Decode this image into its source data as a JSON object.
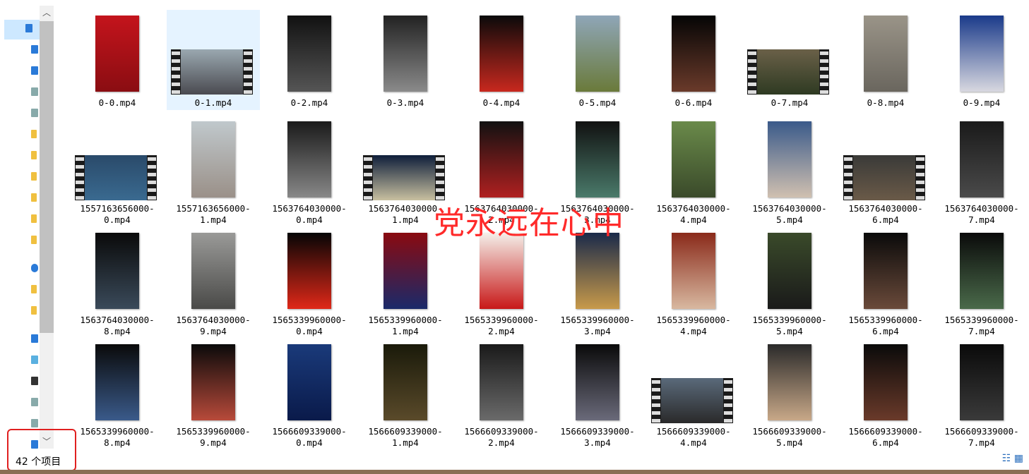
{
  "status": {
    "item_count": "42 个项目"
  },
  "overlay": {
    "text": "党永远在心中"
  },
  "colors": {
    "selection": "#e5f3ff",
    "highlight_box": "#e02020",
    "overlay_text": "#ff2a2a"
  },
  "nav_icons": [
    "quick-access-star-icon",
    "desktop-icon",
    "downloads-icon",
    "documents-icon",
    "pictures-icon",
    "folder-icon",
    "folder-icon",
    "folder-icon",
    "folder-icon",
    "folder-icon",
    "folder-icon",
    "onedrive-icon",
    "folder-icon",
    "folder-icon",
    "this-pc-icon",
    "3d-objects-icon",
    "videos-icon",
    "documents-icon",
    "pictures-icon",
    "downloads-icon"
  ],
  "files": [
    {
      "line1": "0-0.mp4",
      "line2": "",
      "thumb": "portrait",
      "colors": [
        "#c4141c",
        "#8a0d12"
      ],
      "selected": false
    },
    {
      "line1": "0-1.mp4",
      "line2": "",
      "thumb": "landscape",
      "colors": [
        "#9aa8b0",
        "#4a4a50"
      ],
      "selected": true
    },
    {
      "line1": "0-2.mp4",
      "line2": "",
      "thumb": "portrait",
      "colors": [
        "#111",
        "#555"
      ],
      "selected": false
    },
    {
      "line1": "0-3.mp4",
      "line2": "",
      "thumb": "portrait",
      "colors": [
        "#222",
        "#8a8a8a"
      ],
      "selected": false
    },
    {
      "line1": "0-4.mp4",
      "line2": "",
      "thumb": "portrait",
      "colors": [
        "#0a0a0a",
        "#c8281e"
      ],
      "selected": false
    },
    {
      "line1": "0-5.mp4",
      "line2": "",
      "thumb": "portrait",
      "colors": [
        "#8fa6b8",
        "#6a7a3a"
      ],
      "selected": false
    },
    {
      "line1": "0-6.mp4",
      "line2": "",
      "thumb": "portrait",
      "colors": [
        "#050505",
        "#6a3a2a"
      ],
      "selected": false
    },
    {
      "line1": "0-7.mp4",
      "line2": "",
      "thumb": "landscape",
      "colors": [
        "#6a6048",
        "#2e3a22"
      ],
      "selected": false
    },
    {
      "line1": "0-8.mp4",
      "line2": "",
      "thumb": "portrait",
      "colors": [
        "#9a9488",
        "#6a665e"
      ],
      "selected": false
    },
    {
      "line1": "0-9.mp4",
      "line2": "",
      "thumb": "portrait",
      "colors": [
        "#1a3a8a",
        "#d8d8e0"
      ],
      "selected": false
    },
    {
      "line1": "1557163656000-",
      "line2": "0.mp4",
      "thumb": "landscape",
      "colors": [
        "#2a4a6a",
        "#3a6a90"
      ],
      "selected": false
    },
    {
      "line1": "1557163656000-",
      "line2": "1.mp4",
      "thumb": "portrait",
      "colors": [
        "#c0c8cc",
        "#9a9088"
      ],
      "selected": false
    },
    {
      "line1": "1563764030000-",
      "line2": "0.mp4",
      "thumb": "portrait",
      "colors": [
        "#1a1a1a",
        "#888"
      ],
      "selected": false
    },
    {
      "line1": "1563764030000-",
      "line2": "1.mp4",
      "thumb": "landscape",
      "colors": [
        "#0e1e3a",
        "#c8c0a0"
      ],
      "selected": false
    },
    {
      "line1": "1563764030000-",
      "line2": "2.mp4",
      "thumb": "portrait",
      "colors": [
        "#111",
        "#b02020"
      ],
      "selected": false
    },
    {
      "line1": "1563764030000-",
      "line2": "3.mp4",
      "thumb": "portrait",
      "colors": [
        "#111",
        "#4a7a6a"
      ],
      "selected": false
    },
    {
      "line1": "1563764030000-",
      "line2": "4.mp4",
      "thumb": "portrait",
      "colors": [
        "#6a8a4a",
        "#3a4a2a"
      ],
      "selected": false
    },
    {
      "line1": "1563764030000-",
      "line2": "5.mp4",
      "thumb": "portrait",
      "colors": [
        "#3a5a8a",
        "#d0c0b0"
      ],
      "selected": false
    },
    {
      "line1": "1563764030000-",
      "line2": "6.mp4",
      "thumb": "landscape",
      "colors": [
        "#3a3a38",
        "#6a5a48"
      ],
      "selected": false
    },
    {
      "line1": "1563764030000-",
      "line2": "7.mp4",
      "thumb": "portrait",
      "colors": [
        "#1a1a1a",
        "#4a4a4a"
      ],
      "selected": false
    },
    {
      "line1": "1563764030000-",
      "line2": "8.mp4",
      "thumb": "portrait",
      "colors": [
        "#0a0a0a",
        "#3a4a5a"
      ],
      "selected": false
    },
    {
      "line1": "1563764030000-",
      "line2": "9.mp4",
      "thumb": "portrait",
      "colors": [
        "#9a9a98",
        "#4a4a48"
      ],
      "selected": false
    },
    {
      "line1": "1565339960000-",
      "line2": "0.mp4",
      "thumb": "portrait",
      "colors": [
        "#050505",
        "#e02818"
      ],
      "selected": false
    },
    {
      "line1": "1565339960000-",
      "line2": "1.mp4",
      "thumb": "portrait",
      "colors": [
        "#8a0a10",
        "#1a2a6a"
      ],
      "selected": false
    },
    {
      "line1": "1565339960000-",
      "line2": "2.mp4",
      "thumb": "portrait",
      "colors": [
        "#f4f0ea",
        "#c81818"
      ],
      "selected": false
    },
    {
      "line1": "1565339960000-",
      "line2": "3.mp4",
      "thumb": "portrait",
      "colors": [
        "#1a2a4a",
        "#c89a4a"
      ],
      "selected": false
    },
    {
      "line1": "1565339960000-",
      "line2": "4.mp4",
      "thumb": "portrait",
      "colors": [
        "#8a2a1a",
        "#d8b8a0"
      ],
      "selected": false
    },
    {
      "line1": "1565339960000-",
      "line2": "5.mp4",
      "thumb": "portrait",
      "colors": [
        "#3a4a2a",
        "#1a1a1a"
      ],
      "selected": false
    },
    {
      "line1": "1565339960000-",
      "line2": "6.mp4",
      "thumb": "portrait",
      "colors": [
        "#0a0a0a",
        "#6a4a3a"
      ],
      "selected": false
    },
    {
      "line1": "1565339960000-",
      "line2": "7.mp4",
      "thumb": "portrait",
      "colors": [
        "#0a0a0a",
        "#4a6a4a"
      ],
      "selected": false
    },
    {
      "line1": "1565339960000-",
      "line2": "8.mp4",
      "thumb": "portrait",
      "colors": [
        "#0a0a0a",
        "#3a5a8a"
      ],
      "selected": false
    },
    {
      "line1": "1565339960000-",
      "line2": "9.mp4",
      "thumb": "portrait",
      "colors": [
        "#0a0a0a",
        "#b84a3a"
      ],
      "selected": false
    },
    {
      "line1": "1566609339000-",
      "line2": "0.mp4",
      "thumb": "portrait",
      "colors": [
        "#1a3a7a",
        "#0a1a4a"
      ],
      "selected": false
    },
    {
      "line1": "1566609339000-",
      "line2": "1.mp4",
      "thumb": "portrait",
      "colors": [
        "#1a1a0a",
        "#5a4a2a"
      ],
      "selected": false
    },
    {
      "line1": "1566609339000-",
      "line2": "2.mp4",
      "thumb": "portrait",
      "colors": [
        "#1a1a1a",
        "#6a6a6a"
      ],
      "selected": false
    },
    {
      "line1": "1566609339000-",
      "line2": "3.mp4",
      "thumb": "portrait",
      "colors": [
        "#0a0a0a",
        "#6a6a7a"
      ],
      "selected": false
    },
    {
      "line1": "1566609339000-",
      "line2": "4.mp4",
      "thumb": "landscape",
      "colors": [
        "#5a6a7a",
        "#2a2a2a"
      ],
      "selected": false
    },
    {
      "line1": "1566609339000-",
      "line2": "5.mp4",
      "thumb": "portrait",
      "colors": [
        "#2a2a2a",
        "#c8a888"
      ],
      "selected": false
    },
    {
      "line1": "1566609339000-",
      "line2": "6.mp4",
      "thumb": "portrait",
      "colors": [
        "#0a0a0a",
        "#6a3a2a"
      ],
      "selected": false
    },
    {
      "line1": "1566609339000-",
      "line2": "7.mp4",
      "thumb": "portrait",
      "colors": [
        "#0a0a0a",
        "#3a3a3a"
      ],
      "selected": false
    }
  ]
}
